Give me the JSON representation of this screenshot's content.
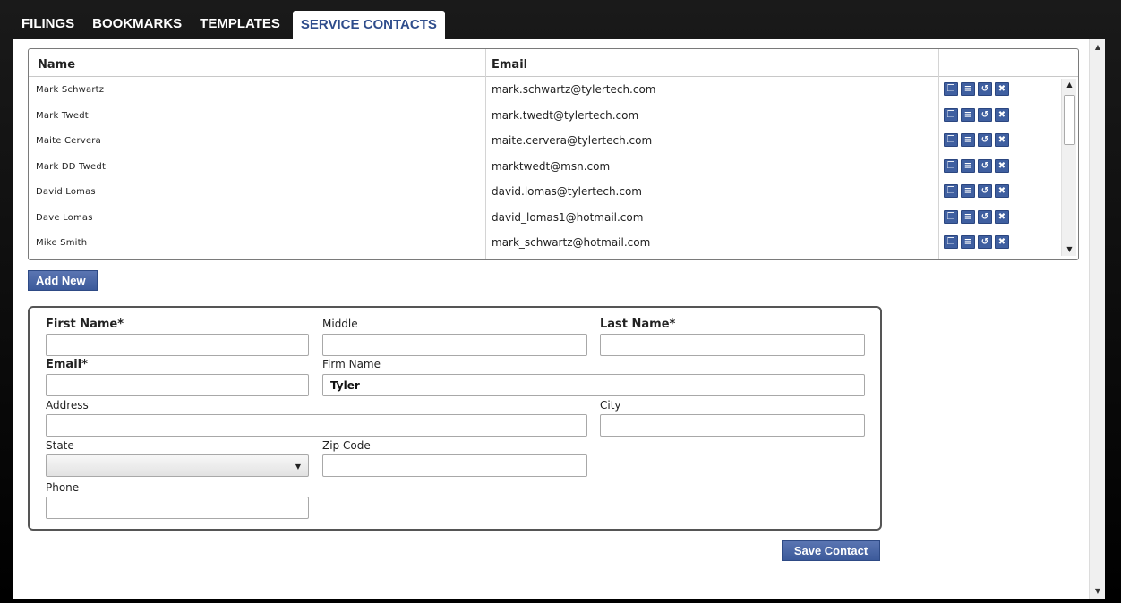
{
  "tabs": [
    "FILINGS",
    "BOOKMARKS",
    "TEMPLATES",
    "SERVICE CONTACTS"
  ],
  "active_tab": "SERVICE CONTACTS",
  "table": {
    "headers": {
      "name": "Name",
      "email": "Email"
    },
    "rows": [
      {
        "name": "Mark  Schwartz",
        "email": "mark.schwartz@tylertech.com"
      },
      {
        "name": "Mark  Twedt",
        "email": "mark.twedt@tylertech.com"
      },
      {
        "name": "Maite  Cervera",
        "email": "maite.cervera@tylertech.com"
      },
      {
        "name": "Mark DD Twedt",
        "email": "marktwedt@msn.com"
      },
      {
        "name": "David  Lomas",
        "email": "david.lomas@tylertech.com"
      },
      {
        "name": "Dave  Lomas",
        "email": "david_lomas1@hotmail.com"
      },
      {
        "name": "Mike  Smith",
        "email": "mark_schwartz@hotmail.com"
      }
    ],
    "row_actions": [
      "copy-icon",
      "details-icon",
      "undo-icon",
      "delete-icon"
    ]
  },
  "add_new_label": "Add New",
  "form": {
    "first_name": {
      "label": "First Name*",
      "value": ""
    },
    "middle": {
      "label": "Middle",
      "value": ""
    },
    "last_name": {
      "label": "Last Name*",
      "value": ""
    },
    "email": {
      "label": "Email*",
      "value": ""
    },
    "firm_name": {
      "label": "Firm Name",
      "value": "Tyler"
    },
    "address": {
      "label": "Address",
      "value": ""
    },
    "city": {
      "label": "City",
      "value": ""
    },
    "state": {
      "label": "State",
      "value": ""
    },
    "zip": {
      "label": "Zip Code",
      "value": ""
    },
    "phone": {
      "label": "Phone",
      "value": ""
    }
  },
  "save_label": "Save Contact",
  "colors": {
    "accent": "#3f5fa0",
    "tab_active_text": "#2f4d8c",
    "frame": "#000000"
  }
}
